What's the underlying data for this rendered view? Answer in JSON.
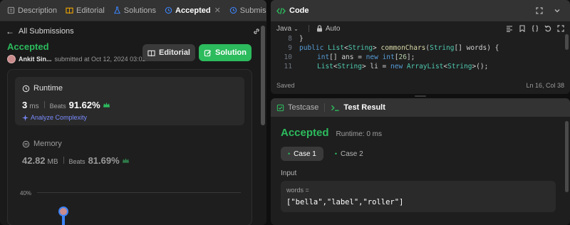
{
  "left_tabs": {
    "description": "Description",
    "editorial": "Editorial",
    "solutions": "Solutions",
    "accepted": "Accepted",
    "close_glyph": "✕",
    "submissions": "Submissions"
  },
  "submissions_bar": {
    "label": "All Submissions"
  },
  "result": {
    "status": "Accepted",
    "author": "Ankit Sin...",
    "submitted_at": "submitted at Oct 12, 2024 03:02"
  },
  "actions": {
    "editorial_label": "Editorial",
    "solution_label": "Solution"
  },
  "runtime": {
    "title": "Runtime",
    "value": "3",
    "unit": "ms",
    "beats_label": "Beats",
    "beats_value": "91.62%",
    "analyze_label": "Analyze Complexity"
  },
  "memory": {
    "title": "Memory",
    "value": "42.82",
    "unit": "MB",
    "beats_label": "Beats",
    "beats_value": "81.69%"
  },
  "chart": {
    "y_tick": "40%"
  },
  "code_panel": {
    "title": "Code",
    "language": "Java",
    "auto_label": "Auto",
    "status": "Saved",
    "cursor": "Ln 16, Col 38",
    "lines": [
      {
        "n": "8",
        "text": "}"
      },
      {
        "n": "9",
        "text": "public List<String> commonChars(String[] words) {"
      },
      {
        "n": "10",
        "text": "int[] ans = new int[26];"
      },
      {
        "n": "11",
        "text": "List<String> li = new ArrayList<String>();"
      }
    ]
  },
  "test_panel": {
    "testcase_tab": "Testcase",
    "result_tab": "Test Result",
    "status": "Accepted",
    "runtime": "Runtime: 0 ms",
    "cases": [
      "Case 1",
      "Case 2"
    ],
    "input_label": "Input",
    "param_name": "words =",
    "param_value": "[\"bella\",\"label\",\"roller\"]"
  },
  "colors": {
    "accent_green": "#2cbb5d",
    "accent_blue": "#7a8cff",
    "crown_green": "#2cbb5d",
    "bg": "#1a1a1a"
  },
  "icons": {
    "description": "description-icon",
    "editorial": "book-icon",
    "solutions": "flask-icon",
    "accepted": "history-icon",
    "submissions": "history-icon",
    "back": "arrow-left-icon",
    "link": "link-icon",
    "runtime": "clock-icon",
    "memory": "chip-icon",
    "analyze": "sparkle-icon",
    "code": "code-brackets-icon",
    "testcase": "checkbox-icon",
    "terminal": "terminal-icon"
  }
}
